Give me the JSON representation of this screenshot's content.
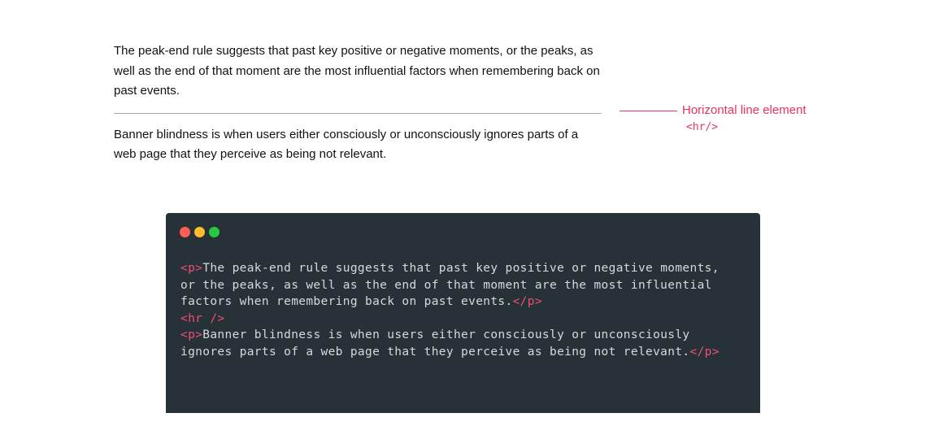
{
  "demo": {
    "paragraph_1": "The peak-end rule suggests that past key positive or negative moments, or the peaks, as well as the end of that moment are the most influential factors when remembering back on past events.",
    "paragraph_2": "Banner blindness is when users either consciously or unconsciously ignores parts of a web page that they perceive as being not relevant."
  },
  "annotation": {
    "label": "Horizontal line element",
    "tag": "<hr/>"
  },
  "code_window": {
    "window_controls": [
      {
        "name": "close",
        "color": "#ff5f56"
      },
      {
        "name": "minimize",
        "color": "#ffbd2e"
      },
      {
        "name": "zoom",
        "color": "#27c93f"
      }
    ],
    "lines": [
      {
        "open": "<p>",
        "text": "The peak-end rule suggests that past key positive or negative moments,",
        "close": ""
      },
      {
        "open": "",
        "text": "or the peaks, as well as the end of that moment are the most influential",
        "close": ""
      },
      {
        "open": "",
        "text": "factors when remembering back on past events.",
        "close": "</p>"
      },
      {
        "open": "<hr />",
        "text": "",
        "close": ""
      },
      {
        "open": "<p>",
        "text": "Banner blindness is when users either consciously or unconsciously",
        "close": ""
      },
      {
        "open": "",
        "text": "ignores parts of a web page that they perceive as being not relevant.",
        "close": "</p>"
      }
    ]
  },
  "colors": {
    "accent": "#e8335f",
    "code_background": "#263238",
    "code_tag": "#ef4f6f",
    "code_text": "#d4dadc",
    "rule": "#a9a9a9"
  }
}
